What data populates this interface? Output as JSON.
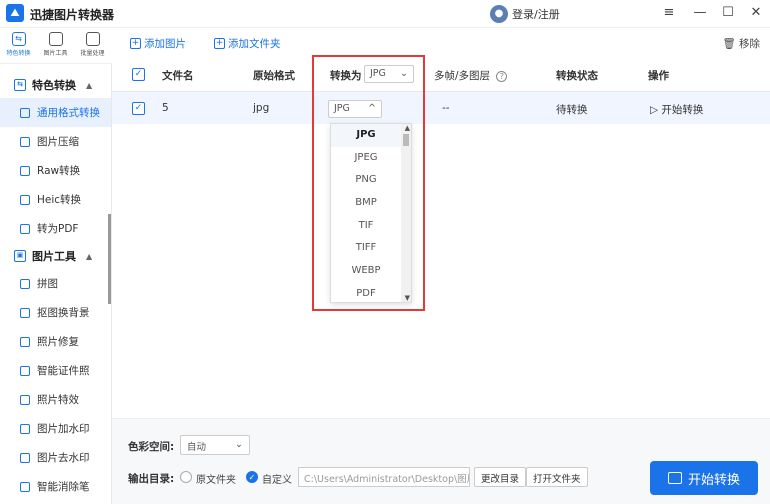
{
  "window": {
    "app_title": "迅捷图片转换器",
    "user_label": "登录/注册",
    "controls": [
      "≡",
      "—",
      "☐",
      "✕"
    ]
  },
  "rail": {
    "tabs": [
      {
        "label": "特色转换",
        "icon": "swap-icon"
      },
      {
        "label": "图片工具",
        "icon": "image-tools-icon"
      },
      {
        "label": "批量处理",
        "icon": "batch-icon"
      }
    ]
  },
  "sidebar": {
    "sections": [
      {
        "title": "特色转换",
        "items": [
          "通用格式转换",
          "图片压缩",
          "Raw转换",
          "Heic转换",
          "转为PDF"
        ]
      },
      {
        "title": "图片工具",
        "items": [
          "拼图",
          "抠图换背景",
          "照片修复",
          "智能证件照",
          "照片特效",
          "图片加水印",
          "图片去水印",
          "智能消除笔"
        ]
      }
    ],
    "active_item": "通用格式转换"
  },
  "toolbar": {
    "add_image": "添加图片",
    "add_folder": "添加文件夹",
    "remove": "移除"
  },
  "table": {
    "columns": {
      "filename": "文件名",
      "original_format": "原始格式",
      "convert_to": "转换为",
      "multiframe": "多帧/多图层",
      "status": "转换状态",
      "action": "操作"
    },
    "header_format": "JPG",
    "rows": [
      {
        "filename": "5",
        "original_format": "jpg",
        "convert_to": "JPG",
        "multiframe": "--",
        "status": "待转换",
        "action": "开始转换"
      }
    ]
  },
  "dropdown": {
    "selected": "JPG",
    "options": [
      "JPG",
      "JPEG",
      "PNG",
      "BMP",
      "TIF",
      "TIFF",
      "WEBP",
      "PDF"
    ]
  },
  "bottom": {
    "color_space_label": "色彩空间:",
    "color_space_value": "自动",
    "output_label": "输出目录:",
    "option_original": "原文件夹",
    "option_custom": "自定义",
    "path": "C:\\Users\\Administrator\\Desktop\\图片",
    "change_dir": "更改目录",
    "open_folder": "打开文件夹",
    "start": "开始转换"
  },
  "colors": {
    "accent": "#1a73e8",
    "highlight": "#e53935"
  }
}
